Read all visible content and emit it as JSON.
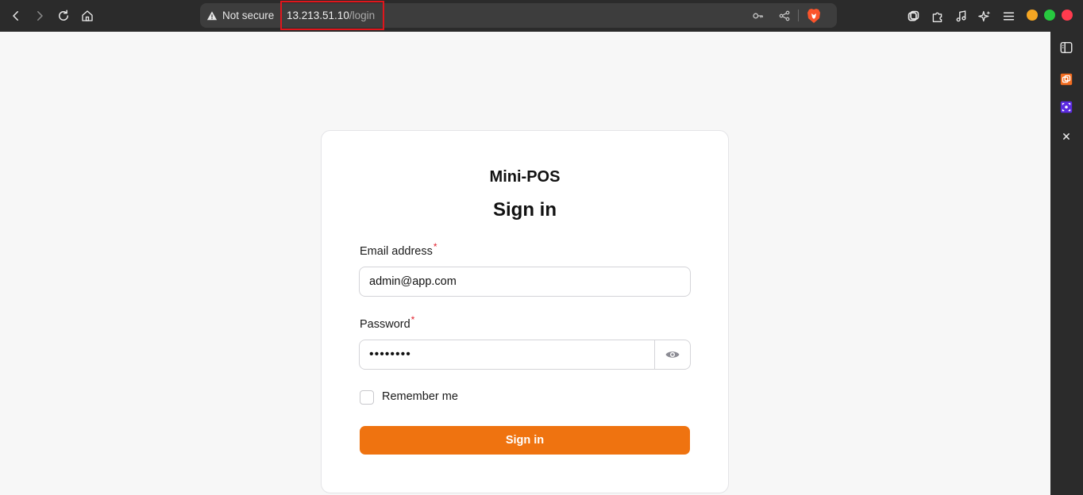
{
  "browser": {
    "security_label": "Not secure",
    "url_host": "13.213.51.10",
    "url_path": "/login",
    "window_dots": [
      "#f5a623",
      "#27c93f",
      "#ff3b4e"
    ]
  },
  "page": {
    "brand": "Mini-POS",
    "title": "Sign in",
    "email_label": "Email address",
    "email_required_mark": "*",
    "email_value": "admin@app.com",
    "password_label": "Password",
    "password_required_mark": "*",
    "password_value": "••••••••",
    "remember_label": "Remember me",
    "remember_checked": false,
    "submit_label": "Sign in",
    "accent_color": "#ef7310"
  },
  "icons": {
    "toolbar": [
      "back-icon",
      "forward-icon",
      "reload-icon",
      "home-icon"
    ],
    "urlbar": [
      "warning-icon",
      "key-icon",
      "share-icon",
      "brave-shield-icon"
    ],
    "extensions": [
      "tab-manager-icon",
      "puzzle-icon",
      "music-icon",
      "sparkle-icon",
      "menu-icon"
    ],
    "sidepanel": [
      "sidebar-toggle-icon",
      "orange-extension-icon",
      "purple-extension-icon",
      "close-icon"
    ]
  }
}
